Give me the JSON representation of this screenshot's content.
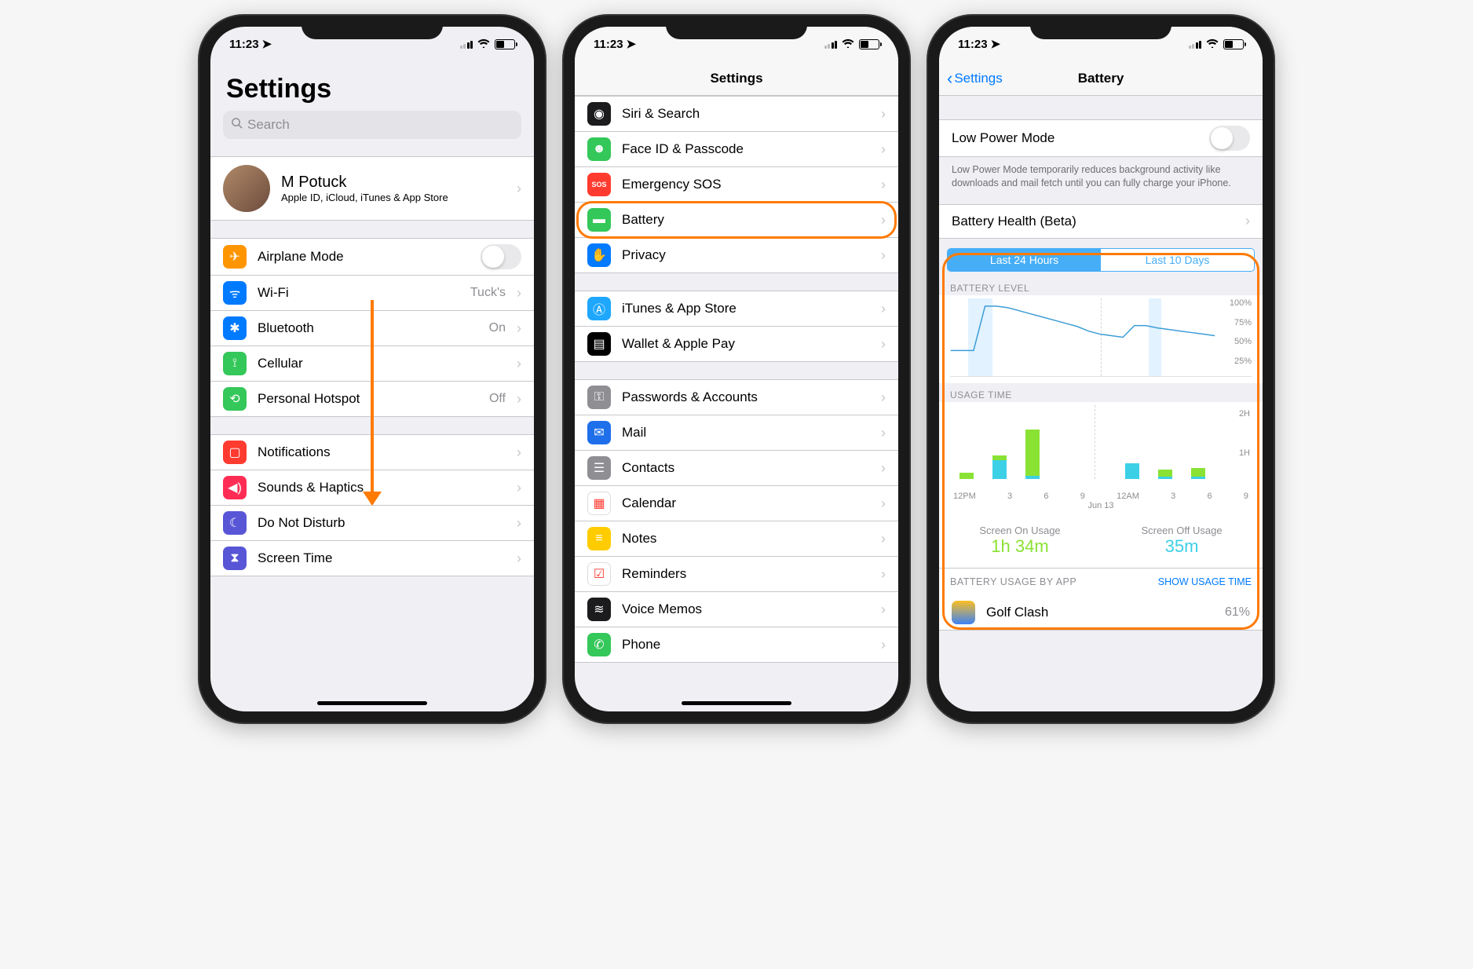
{
  "status": {
    "time": "11:23",
    "loc_icon": "location-arrow"
  },
  "screen1": {
    "title": "Settings",
    "search_placeholder": "Search",
    "profile": {
      "name": "M Potuck",
      "sub": "Apple ID, iCloud, iTunes & App Store"
    },
    "groupA": [
      {
        "key": "airplane",
        "label": "Airplane Mode",
        "toggle": false,
        "color": "#ff9500",
        "icon": "airplane"
      },
      {
        "key": "wifi",
        "label": "Wi-Fi",
        "detail": "Tuck's",
        "color": "#007aff",
        "icon": "wifi"
      },
      {
        "key": "bluetooth",
        "label": "Bluetooth",
        "detail": "On",
        "color": "#007aff",
        "icon": "bluetooth"
      },
      {
        "key": "cellular",
        "label": "Cellular",
        "color": "#34c759",
        "icon": "antenna"
      },
      {
        "key": "hotspot",
        "label": "Personal Hotspot",
        "detail": "Off",
        "color": "#34c759",
        "icon": "link"
      }
    ],
    "groupB": [
      {
        "key": "notifications",
        "label": "Notifications",
        "color": "#ff3b30",
        "icon": "bell"
      },
      {
        "key": "sounds",
        "label": "Sounds & Haptics",
        "color": "#ff2d55",
        "icon": "speaker"
      },
      {
        "key": "dnd",
        "label": "Do Not Disturb",
        "color": "#5856d6",
        "icon": "moon"
      },
      {
        "key": "screentime",
        "label": "Screen Time",
        "color": "#5856d6",
        "icon": "hourglass"
      }
    ]
  },
  "screen2": {
    "nav_title": "Settings",
    "items": [
      {
        "key": "siri",
        "label": "Siri & Search",
        "color": "#1c1c1e",
        "icon": "siri"
      },
      {
        "key": "faceid",
        "label": "Face ID & Passcode",
        "color": "#34c759",
        "icon": "face"
      },
      {
        "key": "sos",
        "label": "Emergency SOS",
        "color": "#ff3b30",
        "icon": "sos",
        "text": "SOS"
      },
      {
        "key": "battery",
        "label": "Battery",
        "color": "#34c759",
        "icon": "battery",
        "highlight": true
      },
      {
        "key": "privacy",
        "label": "Privacy",
        "color": "#007aff",
        "icon": "hand"
      }
    ],
    "items2": [
      {
        "key": "itunes",
        "label": "iTunes & App Store",
        "color": "#1ea7fd",
        "icon": "appstore"
      },
      {
        "key": "wallet",
        "label": "Wallet & Apple Pay",
        "color": "#000",
        "icon": "wallet"
      }
    ],
    "items3": [
      {
        "key": "passwords",
        "label": "Passwords & Accounts",
        "color": "#8e8e93",
        "icon": "key"
      },
      {
        "key": "mail",
        "label": "Mail",
        "color": "#1f6feb",
        "icon": "mail"
      },
      {
        "key": "contacts",
        "label": "Contacts",
        "color": "#8e8e93",
        "icon": "contacts"
      },
      {
        "key": "calendar",
        "label": "Calendar",
        "color": "#fff",
        "icon": "calendar"
      },
      {
        "key": "notes",
        "label": "Notes",
        "color": "#ffcc00",
        "icon": "notes"
      },
      {
        "key": "reminders",
        "label": "Reminders",
        "color": "#fff",
        "icon": "reminders"
      },
      {
        "key": "voicememos",
        "label": "Voice Memos",
        "color": "#1c1c1e",
        "icon": "voice"
      },
      {
        "key": "phone",
        "label": "Phone",
        "color": "#34c759",
        "icon": "phone"
      }
    ]
  },
  "screen3": {
    "back": "Settings",
    "nav_title": "Battery",
    "lpm_label": "Low Power Mode",
    "lpm_desc": "Low Power Mode temporarily reduces background activity like downloads and mail fetch until you can fully charge your iPhone.",
    "health_label": "Battery Health (Beta)",
    "seg": {
      "a": "Last 24 Hours",
      "b": "Last 10 Days"
    },
    "level_label": "BATTERY LEVEL",
    "usage_label": "USAGE TIME",
    "yticks_level": [
      "100%",
      "75%",
      "50%",
      "25%"
    ],
    "yticks_usage": [
      "2H",
      "1H"
    ],
    "xticks": [
      "12PM",
      "3",
      "6",
      "9",
      "12AM",
      "3",
      "6",
      "9"
    ],
    "xdate": "Jun 13",
    "screen_on_label": "Screen On Usage",
    "screen_on_value": "1h 34m",
    "screen_off_label": "Screen Off Usage",
    "screen_off_value": "35m",
    "by_app_label": "BATTERY USAGE BY APP",
    "show_usage": "SHOW USAGE TIME",
    "first_app": "Golf Clash",
    "first_app_pct": "61%"
  },
  "chart_data": {
    "battery_level": {
      "type": "line",
      "title": "BATTERY LEVEL",
      "x": [
        "12PM",
        "1",
        "2",
        "3",
        "4",
        "5",
        "6",
        "7",
        "8",
        "9",
        "10",
        "11",
        "12AM",
        "1",
        "2",
        "3",
        "4",
        "5",
        "6",
        "7",
        "8",
        "9",
        "10",
        "11"
      ],
      "values": [
        33,
        33,
        33,
        90,
        90,
        88,
        84,
        80,
        76,
        72,
        68,
        64,
        58,
        54,
        52,
        50,
        65,
        65,
        62,
        60,
        58,
        56,
        54,
        52
      ],
      "charging_bands_hours": [
        [
          "2",
          "3"
        ],
        [
          "3",
          "4"
        ]
      ],
      "ylim": [
        0,
        100
      ],
      "ylabel": "%"
    },
    "usage_time": {
      "type": "bar",
      "title": "USAGE TIME",
      "categories": [
        "12PM",
        "3",
        "6",
        "9",
        "12AM",
        "3",
        "6",
        "9"
      ],
      "series": [
        {
          "name": "Screen Off",
          "color": "#3cd0e6",
          "values_minutes": [
            0,
            30,
            5,
            0,
            0,
            25,
            3,
            3
          ]
        },
        {
          "name": "Screen On",
          "color": "#8ae234",
          "values_minutes": [
            10,
            8,
            75,
            0,
            0,
            0,
            12,
            15
          ]
        }
      ],
      "ylim_hours": [
        0,
        2
      ]
    },
    "totals": {
      "screen_on": "1h 34m",
      "screen_off": "35m"
    }
  }
}
